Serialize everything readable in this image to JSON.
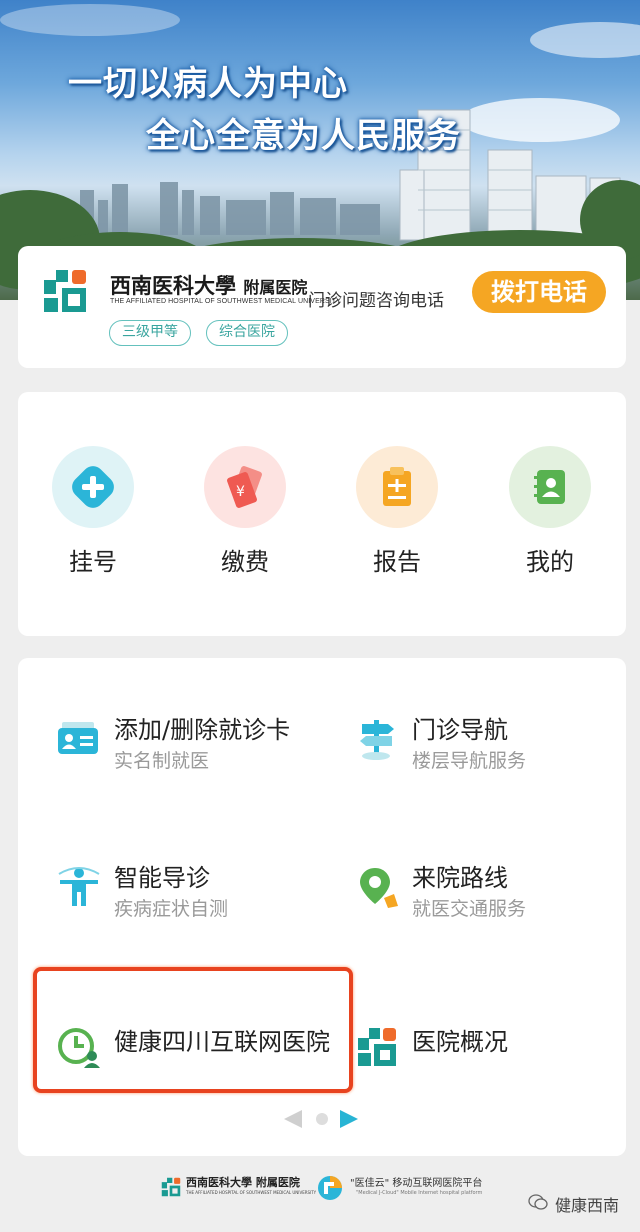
{
  "banner": {
    "slogan_line1": "一切以病人为中心",
    "slogan_line2": "全心全意为人民服务"
  },
  "hospital": {
    "name_cn": "西南医科大學",
    "name_suffix": "附属医院",
    "name_en": "THE AFFILIATED HOSPITAL OF SOUTHWEST MEDICAL UNIVERSITY",
    "badges": [
      "三级甲等",
      "综合医院"
    ],
    "consult_label": "门诊问题咨询电话",
    "call_button": "拨打电话",
    "logo_colors": {
      "teal": "#1a9a92",
      "orange": "#ef6b2b"
    }
  },
  "menu": [
    {
      "label": "挂号",
      "icon": "plus-cross-icon",
      "bg": "#dff3f6",
      "color": "#2bb5d8"
    },
    {
      "label": "缴费",
      "icon": "payment-card-icon",
      "bg": "#fde3e1",
      "color": "#ef5a52"
    },
    {
      "label": "报告",
      "icon": "report-clipboard-icon",
      "bg": "#fdebd6",
      "color": "#f5a623"
    },
    {
      "label": "我的",
      "icon": "profile-book-icon",
      "bg": "#e3f1df",
      "color": "#58b250"
    }
  ],
  "services": [
    {
      "title": "添加/删除就诊卡",
      "subtitle": "实名制就医",
      "icon": "id-card-icon"
    },
    {
      "title": "门诊导航",
      "subtitle": "楼层导航服务",
      "icon": "signpost-icon"
    },
    {
      "title": "智能导诊",
      "subtitle": "疾病症状自测",
      "icon": "body-figure-icon"
    },
    {
      "title": "来院路线",
      "subtitle": "就医交通服务",
      "icon": "location-pin-icon"
    },
    {
      "title": "健康四川互联网医院",
      "subtitle": "",
      "icon": "clock-doctor-icon"
    },
    {
      "title": "医院概况",
      "subtitle": "",
      "icon": "hospital-logo-icon"
    }
  ],
  "highlight_color": "#e8431f",
  "footer": {
    "hospital_name": "西南医科大學 附属医院",
    "hospital_en": "THE AFFILIATED HOSPITAL OF SOUTHWEST MEDICAL UNIVERSITY",
    "platform_name": "\"医佳云\" 移动互联网医院平台",
    "platform_en": "\"Medical J-Cloud\" Mobile Internet hospital platform",
    "source": "健康西南"
  }
}
